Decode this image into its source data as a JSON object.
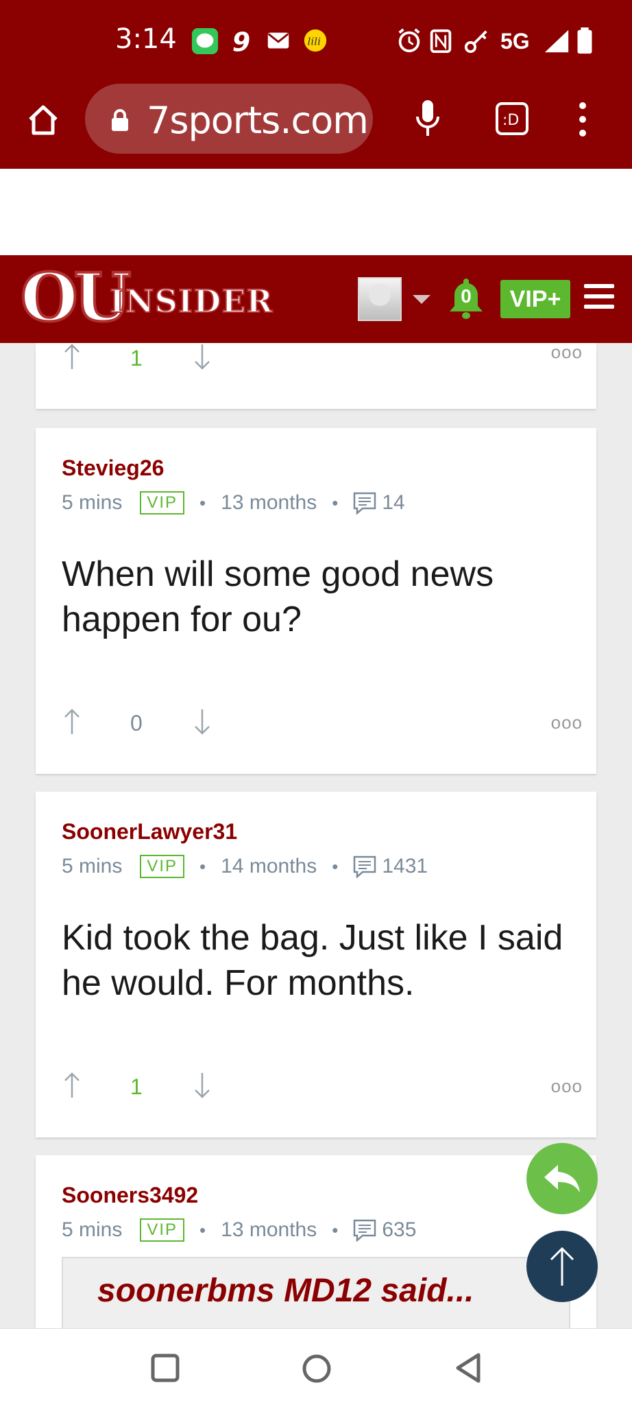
{
  "status_bar": {
    "time": "3:14",
    "network": "5G"
  },
  "browser": {
    "url": "7sports.com"
  },
  "site_header": {
    "logo_ou": "OU",
    "logo_insider": "INSIDER",
    "notification_count": "0",
    "vip_button": "VIP+"
  },
  "comments": [
    {
      "votes": "1",
      "more": "ooo"
    },
    {
      "username": "Stevieg26",
      "time": "5 mins",
      "badge": "VIP",
      "tenure": "13 months",
      "post_count": "14",
      "text": "When will some good news happen for ou?",
      "votes": "0",
      "more": "ooo"
    },
    {
      "username": "SoonerLawyer31",
      "time": "5 mins",
      "badge": "VIP",
      "tenure": "14 months",
      "post_count": "1431",
      "text": "Kid took the bag. Just like I said he would. For months.",
      "votes": "1",
      "more": "ooo"
    },
    {
      "username": "Sooners3492",
      "time": "5 mins",
      "badge": "VIP",
      "tenure": "13 months",
      "post_count": "635",
      "quote": "soonerbms MD12 said..."
    }
  ],
  "colors": {
    "brand_red": "#8b0000",
    "vip_green": "#5cb82e",
    "upvote_green": "#5cb82e",
    "meta_gray": "#7a8a9a",
    "scroll_top_navy": "#1f3d57"
  }
}
